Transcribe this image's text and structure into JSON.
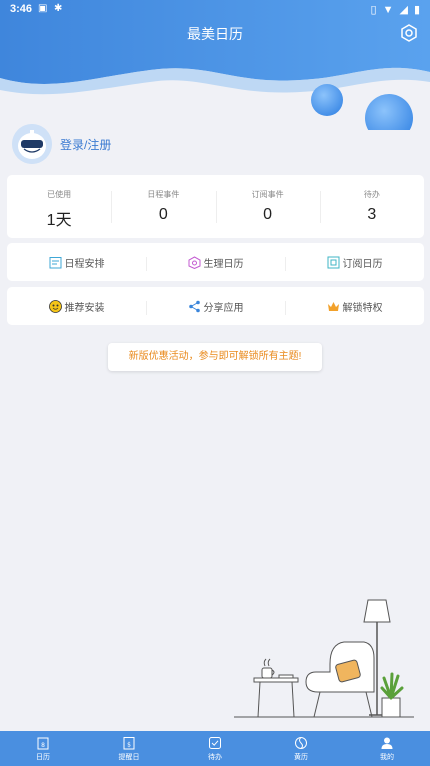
{
  "status": {
    "time": "3:46"
  },
  "header": {
    "title": "最美日历"
  },
  "user": {
    "login_label": "登录/注册"
  },
  "stats": [
    {
      "label": "已使用",
      "value": "1天"
    },
    {
      "label": "日程事件",
      "value": "0"
    },
    {
      "label": "订阅事件",
      "value": "0"
    },
    {
      "label": "待办",
      "value": "3"
    }
  ],
  "row1": [
    {
      "icon": "schedule-icon",
      "label": "日程安排"
    },
    {
      "icon": "period-icon",
      "label": "生理日历"
    },
    {
      "icon": "subscribe-icon",
      "label": "订阅日历"
    }
  ],
  "row2": [
    {
      "icon": "recommend-icon",
      "label": "推荐安装"
    },
    {
      "icon": "share-icon",
      "label": "分享应用"
    },
    {
      "icon": "crown-icon",
      "label": "解锁特权"
    }
  ],
  "promo": {
    "text": "新版优惠活动，参与即可解锁所有主题!"
  },
  "tabs": [
    {
      "label": "日历",
      "icon": "calendar-icon"
    },
    {
      "label": "提醒日",
      "icon": "reminder-icon"
    },
    {
      "label": "待办",
      "icon": "todo-icon"
    },
    {
      "label": "黄历",
      "icon": "almanac-icon"
    },
    {
      "label": "我的",
      "icon": "profile-icon"
    }
  ],
  "colors": {
    "primary": "#4a8fe0",
    "accent": "#e98a1c",
    "link": "#3a7ad1"
  }
}
